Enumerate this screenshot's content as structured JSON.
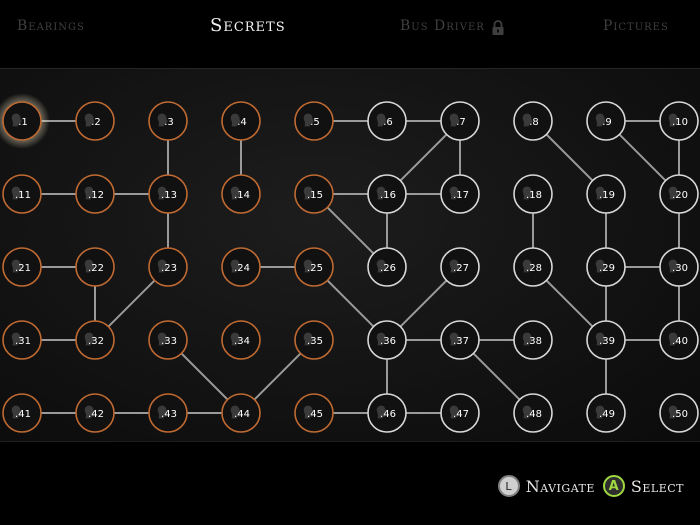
{
  "tabs": [
    {
      "label": "Bearings",
      "active": false
    },
    {
      "label": "Secrets",
      "active": true
    },
    {
      "label": "Bus Driver",
      "active": false,
      "locked": true
    },
    {
      "label": "Pictures",
      "active": false
    }
  ],
  "grid": {
    "rows": 5,
    "cols": 10,
    "labels": [
      ".1",
      ".2",
      ".3",
      ".4",
      ".5",
      ".6",
      ".7",
      ".8",
      ".9",
      ".10",
      ".11",
      ".12",
      ".13",
      ".14",
      ".15",
      ".16",
      ".17",
      ".18",
      ".19",
      ".20",
      ".21",
      ".22",
      ".23",
      ".24",
      ".25",
      ".26",
      ".27",
      ".28",
      ".29",
      ".30",
      ".31",
      ".32",
      ".33",
      ".34",
      ".35",
      ".36",
      ".37",
      ".38",
      ".39",
      ".40",
      ".41",
      ".42",
      ".43",
      ".44",
      ".45",
      ".46",
      ".47",
      ".48",
      ".49",
      ".50"
    ],
    "collected": [
      1,
      2,
      3,
      4,
      5,
      11,
      12,
      13,
      14,
      15,
      21,
      22,
      23,
      24,
      25,
      31,
      32,
      33,
      34,
      35,
      41,
      42,
      43,
      44,
      45
    ],
    "selected": 1,
    "links": [
      [
        1,
        2
      ],
      [
        3,
        13
      ],
      [
        4,
        14
      ],
      [
        5,
        6
      ],
      [
        6,
        7
      ],
      [
        11,
        12
      ],
      [
        12,
        13
      ],
      [
        13,
        23
      ],
      [
        15,
        16
      ],
      [
        16,
        7
      ],
      [
        16,
        17
      ],
      [
        16,
        26
      ],
      [
        15,
        26
      ],
      [
        7,
        17
      ],
      [
        9,
        10
      ],
      [
        9,
        20
      ],
      [
        10,
        20
      ],
      [
        8,
        19
      ],
      [
        18,
        28
      ],
      [
        19,
        29
      ],
      [
        21,
        22
      ],
      [
        22,
        32
      ],
      [
        23,
        32
      ],
      [
        24,
        25
      ],
      [
        25,
        36
      ],
      [
        27,
        36
      ],
      [
        20,
        30
      ],
      [
        29,
        30
      ],
      [
        29,
        39
      ],
      [
        28,
        39
      ],
      [
        31,
        32
      ],
      [
        33,
        44
      ],
      [
        35,
        44
      ],
      [
        36,
        37
      ],
      [
        37,
        38
      ],
      [
        37,
        48
      ],
      [
        36,
        46
      ],
      [
        39,
        40
      ],
      [
        39,
        49
      ],
      [
        30,
        40
      ],
      [
        41,
        42
      ],
      [
        42,
        43
      ],
      [
        43,
        44
      ],
      [
        45,
        46
      ],
      [
        46,
        47
      ]
    ]
  },
  "colors": {
    "collected_ring": "#c06a32",
    "uncollected_ring": "#d8d8d8",
    "link": "#9a9a9a",
    "selected_glow": "#f3e6c4",
    "prompt_a": "#9fd93f"
  },
  "prompts": {
    "navigate_label": "Navigate",
    "navigate_button": "L",
    "select_label": "Select",
    "select_button": "A"
  },
  "icons": {
    "node_icon": "silhouette-head-icon",
    "lock_icon": "padlock-icon"
  }
}
